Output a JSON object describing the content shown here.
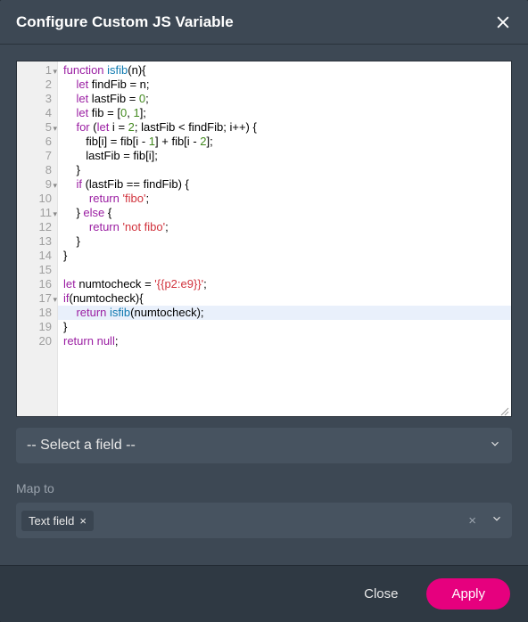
{
  "header": {
    "title": "Configure Custom JS Variable"
  },
  "code": {
    "lines": [
      {
        "n": 1,
        "fold": true,
        "seg": [
          [
            "kw",
            "function"
          ],
          [
            "",
            " "
          ],
          [
            "fn",
            "isfib"
          ],
          [
            "",
            "(n){"
          ]
        ]
      },
      {
        "n": 2,
        "seg": [
          [
            "",
            "    "
          ],
          [
            "kw",
            "let"
          ],
          [
            "",
            " findFib "
          ],
          [
            "",
            "="
          ],
          [
            "",
            " n;"
          ]
        ]
      },
      {
        "n": 3,
        "seg": [
          [
            "",
            "    "
          ],
          [
            "kw",
            "let"
          ],
          [
            "",
            " lastFib "
          ],
          [
            "",
            "="
          ],
          [
            "",
            " "
          ],
          [
            "nm",
            "0"
          ],
          [
            "",
            ";"
          ]
        ]
      },
      {
        "n": 4,
        "seg": [
          [
            "",
            "    "
          ],
          [
            "kw",
            "let"
          ],
          [
            "",
            " fib "
          ],
          [
            "",
            "="
          ],
          [
            "",
            " ["
          ],
          [
            "nm",
            "0"
          ],
          [
            "",
            ", "
          ],
          [
            "nm",
            "1"
          ],
          [
            "",
            "];"
          ]
        ]
      },
      {
        "n": 5,
        "fold": true,
        "seg": [
          [
            "",
            "    "
          ],
          [
            "kw",
            "for"
          ],
          [
            "",
            " ("
          ],
          [
            "kw",
            "let"
          ],
          [
            "",
            " i "
          ],
          [
            "",
            "="
          ],
          [
            "",
            " "
          ],
          [
            "nm",
            "2"
          ],
          [
            "",
            "; lastFib "
          ],
          [
            "",
            "<"
          ],
          [
            "",
            " findFib; i"
          ],
          [
            "",
            "++"
          ],
          [
            "",
            ") {"
          ]
        ]
      },
      {
        "n": 6,
        "seg": [
          [
            "",
            "       fib[i] "
          ],
          [
            "",
            "="
          ],
          [
            "",
            " fib[i "
          ],
          [
            "",
            "-"
          ],
          [
            "",
            " "
          ],
          [
            "nm",
            "1"
          ],
          [
            "",
            "] "
          ],
          [
            "",
            "+"
          ],
          [
            "",
            " fib[i "
          ],
          [
            "",
            "-"
          ],
          [
            "",
            " "
          ],
          [
            "nm",
            "2"
          ],
          [
            "",
            "];"
          ]
        ]
      },
      {
        "n": 7,
        "seg": [
          [
            "",
            "       lastFib "
          ],
          [
            "",
            "="
          ],
          [
            "",
            " fib[i];"
          ]
        ]
      },
      {
        "n": 8,
        "seg": [
          [
            "",
            "    }"
          ]
        ]
      },
      {
        "n": 9,
        "fold": true,
        "seg": [
          [
            "",
            "    "
          ],
          [
            "kw",
            "if"
          ],
          [
            "",
            " (lastFib "
          ],
          [
            "",
            "=="
          ],
          [
            "",
            " findFib) {"
          ]
        ]
      },
      {
        "n": 10,
        "seg": [
          [
            "",
            "        "
          ],
          [
            "kw",
            "return"
          ],
          [
            "",
            " "
          ],
          [
            "st",
            "'fibo'"
          ],
          [
            "",
            ";"
          ]
        ]
      },
      {
        "n": 11,
        "fold": true,
        "seg": [
          [
            "",
            "    } "
          ],
          [
            "kw",
            "else"
          ],
          [
            "",
            " {"
          ]
        ]
      },
      {
        "n": 12,
        "seg": [
          [
            "",
            "        "
          ],
          [
            "kw",
            "return"
          ],
          [
            "",
            " "
          ],
          [
            "st",
            "'not fibo'"
          ],
          [
            "",
            ";"
          ]
        ]
      },
      {
        "n": 13,
        "seg": [
          [
            "",
            "    }"
          ]
        ]
      },
      {
        "n": 14,
        "seg": [
          [
            "",
            "}"
          ]
        ]
      },
      {
        "n": 15,
        "seg": [
          [
            "",
            ""
          ]
        ]
      },
      {
        "n": 16,
        "seg": [
          [
            "kw",
            "let"
          ],
          [
            "",
            " numtocheck "
          ],
          [
            "",
            "="
          ],
          [
            "",
            " "
          ],
          [
            "st",
            "'{{p2:e9}}'"
          ],
          [
            "",
            ";"
          ]
        ]
      },
      {
        "n": 17,
        "fold": true,
        "seg": [
          [
            "kw",
            "if"
          ],
          [
            "",
            "(numtocheck){"
          ]
        ]
      },
      {
        "n": 18,
        "hl": true,
        "seg": [
          [
            "",
            "    "
          ],
          [
            "kw",
            "return"
          ],
          [
            "",
            " "
          ],
          [
            "fn",
            "isfib"
          ],
          [
            "",
            "(numtocheck);"
          ]
        ]
      },
      {
        "n": 19,
        "seg": [
          [
            "",
            "}"
          ]
        ]
      },
      {
        "n": 20,
        "seg": [
          [
            "kw",
            "return"
          ],
          [
            "",
            " "
          ],
          [
            "kw",
            "null"
          ],
          [
            "",
            ";"
          ]
        ]
      }
    ]
  },
  "field_select": {
    "placeholder": "-- Select a field --"
  },
  "map": {
    "label": "Map to",
    "chip": "Text field"
  },
  "footer": {
    "close": "Close",
    "apply": "Apply"
  }
}
